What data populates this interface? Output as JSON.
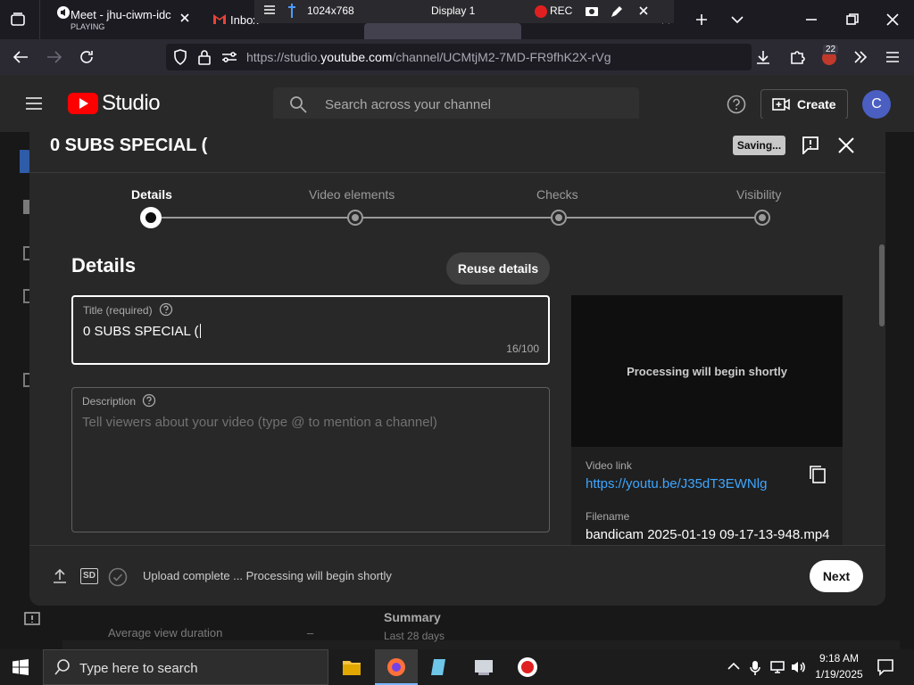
{
  "browser": {
    "tabs": [
      {
        "title": "Meet - jhu-ciwm-idc",
        "subtitle": "PLAYING"
      },
      {
        "title": "Inbox"
      }
    ],
    "url_prefix": "https://studio.",
    "url_domain": "youtube.com",
    "url_suffix": "/channel/UCMtjM2-7MD-FR9fhK2X-rVg",
    "extensions_badge": "22"
  },
  "recorder": {
    "resolution": "1024x768",
    "display": "Display 1",
    "rec_label": "REC"
  },
  "studio": {
    "logo_text": "Studio",
    "search_placeholder": "Search across your channel",
    "create_label": "Create",
    "avatar_letter": "C",
    "background": {
      "summary": "Summary",
      "last_days": "Last 28 days",
      "avg_view": "Average view duration",
      "avg_dash": "–"
    }
  },
  "modal": {
    "title": "0 SUBS SPECIAL (",
    "saving": "Saving...",
    "steps": [
      "Details",
      "Video elements",
      "Checks",
      "Visibility"
    ],
    "details_heading": "Details",
    "reuse_label": "Reuse details",
    "title_field": {
      "label": "Title (required)",
      "value": "0 SUBS SPECIAL (",
      "count": "16/100"
    },
    "description_field": {
      "label": "Description",
      "placeholder": "Tell viewers about your video (type @ to mention a channel)"
    },
    "preview_text": "Processing will begin shortly",
    "video_link_label": "Video link",
    "video_link": "https://youtu.be/J35dT3EWNlg",
    "filename_label": "Filename",
    "filename": "bandicam 2025-01-19 09-17-13-948.mp4",
    "footer_status": "Upload complete ... Processing will begin shortly",
    "sd_badge": "SD",
    "next_label": "Next"
  },
  "taskbar": {
    "search_placeholder": "Type here to search",
    "time": "9:18 AM",
    "date": "1/19/2025"
  },
  "colors": {
    "accent_link": "#3ea6ff",
    "yt_red": "#ff0000",
    "rec_red": "#e02020"
  }
}
